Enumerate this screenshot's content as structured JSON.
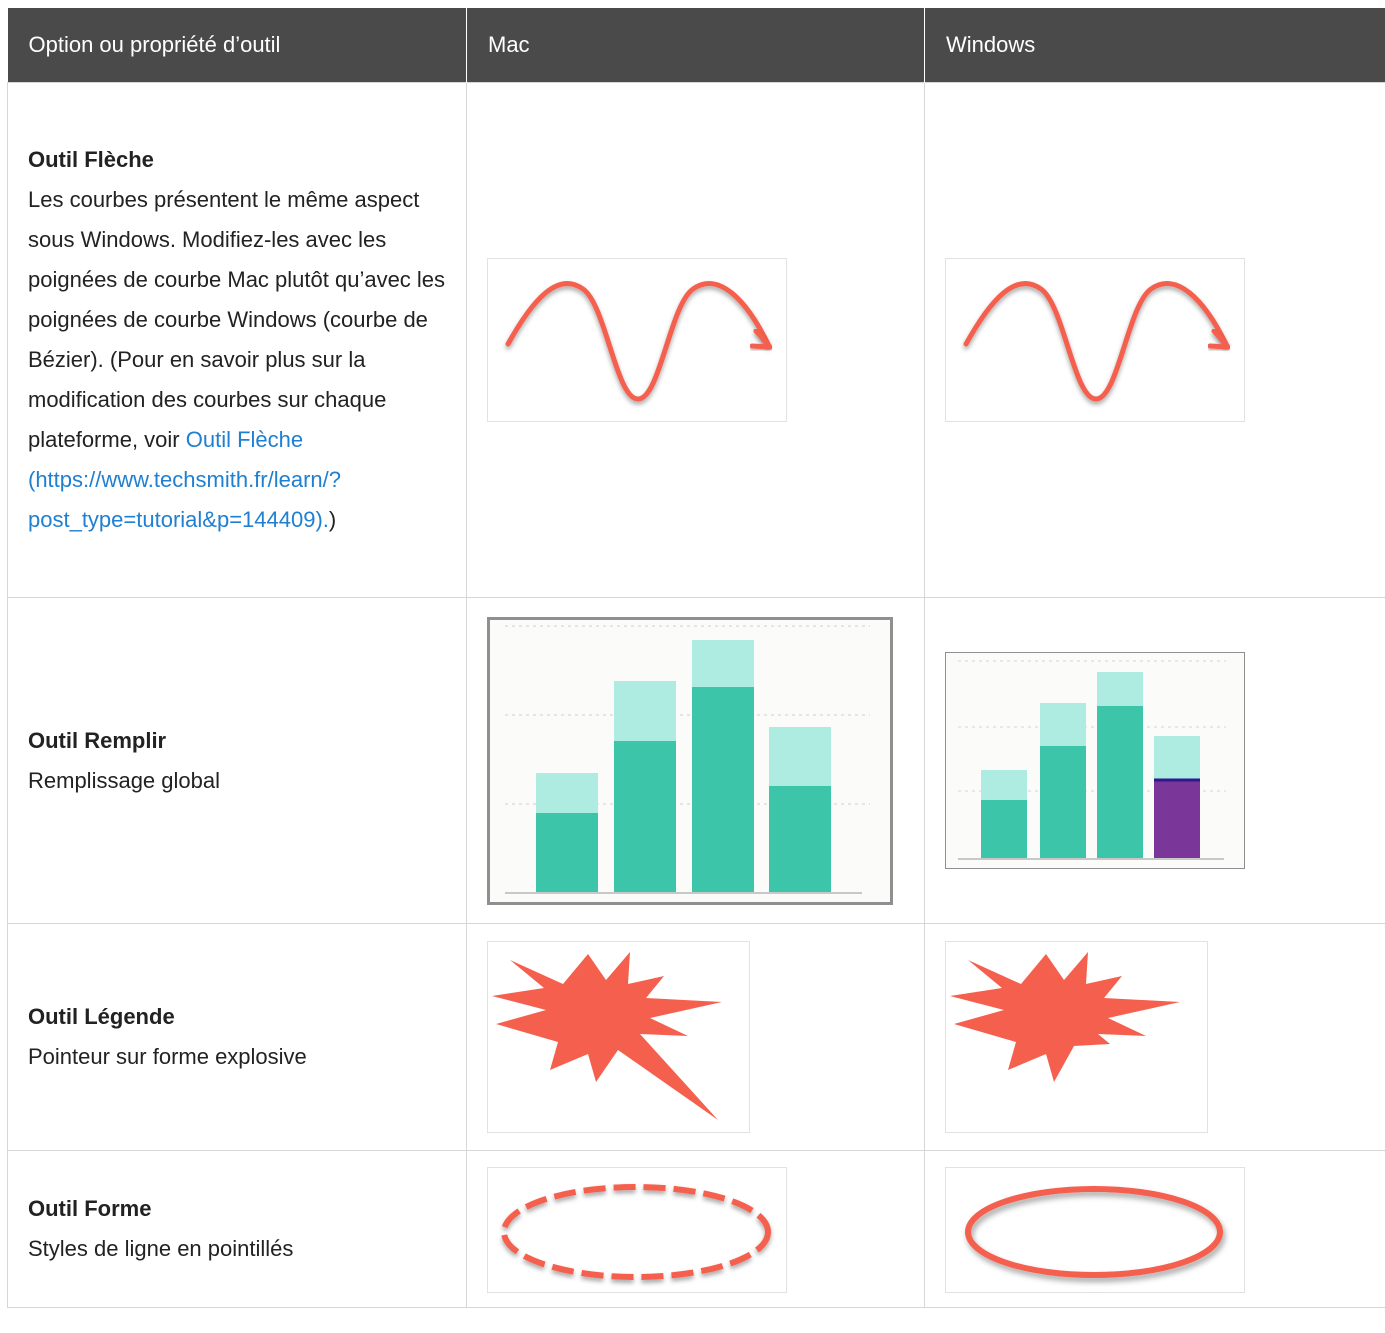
{
  "table": {
    "headers": [
      "Option ou propriété d’outil",
      "Mac",
      "Windows"
    ],
    "rows": [
      {
        "title": "Outil Flèche",
        "description_before": "Les courbes présentent le même aspect sous Windows. Modifiez-les avec les poignées de courbe Mac plutôt qu’avec les poignées de courbe Windows (courbe de Bézier). (Pour en savoir plus sur la modification des courbes sur chaque plateforme, voir ",
        "link_text": "Outil Flèche (https://www.techsmith.fr/learn/?post_type=tutorial&p=144409).",
        "description_after": ")",
        "mac_image": "curved-arrow-mac",
        "windows_image": "curved-arrow-windows"
      },
      {
        "title": "Outil Remplir",
        "description": "Remplissage global",
        "mac_image": "bar-chart-fill-mac",
        "windows_image": "bar-chart-fill-windows"
      },
      {
        "title": "Outil Légende",
        "description": "Pointeur sur forme explosive",
        "mac_image": "explosion-callout-mac",
        "windows_image": "explosion-callout-windows"
      },
      {
        "title": "Outil Forme",
        "description": "Styles de ligne en pointillés",
        "mac_image": "dashed-ellipse-mac",
        "windows_image": "solid-ellipse-windows"
      }
    ]
  },
  "colors": {
    "header_bg": "#4a4a4a",
    "link": "#1f7fd1",
    "accent_red": "#f4604d",
    "teal": "#3cc5a9",
    "teal_light": "#aeebe1",
    "purple": "#7b3699"
  }
}
